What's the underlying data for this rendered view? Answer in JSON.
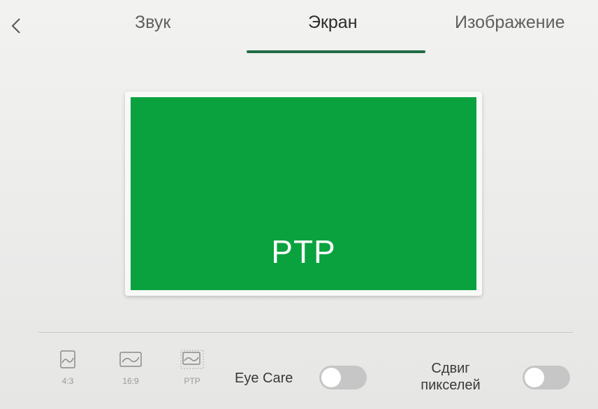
{
  "nav": {
    "back_icon": "chevron-left-icon"
  },
  "tabs": [
    {
      "label": "Звук",
      "active": false
    },
    {
      "label": "Экран",
      "active": true
    },
    {
      "label": "Изображение",
      "active": false
    }
  ],
  "preview": {
    "label": "PTP",
    "screen_color": "#0aa23f"
  },
  "aspect_modes": [
    {
      "label": "4:3",
      "icon": "aspect-4-3-icon"
    },
    {
      "label": "16:9",
      "icon": "aspect-16-9-icon"
    },
    {
      "label": "PTP",
      "icon": "aspect-ptp-icon"
    }
  ],
  "settings": {
    "eye_care_label": "Eye Care",
    "eye_care_on": false,
    "pixel_shift_line1": "Сдвиг",
    "pixel_shift_line2": "пикселей",
    "pixel_shift_on": false
  },
  "colors": {
    "accent": "#1f6b45",
    "toggle_off": "#c6c6c6"
  }
}
